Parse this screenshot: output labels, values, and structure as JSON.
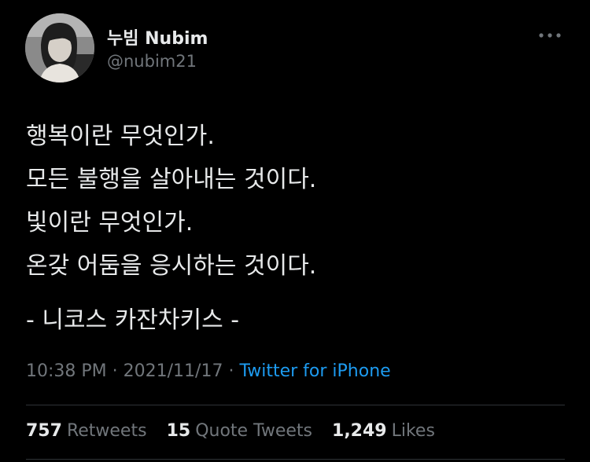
{
  "author": {
    "name": "누빔 Nubim",
    "handle": "@nubim21"
  },
  "tweet": {
    "lines": [
      "행복이란 무엇인가.",
      "모든 불행을 살아내는 것이다.",
      "빛이란 무엇인가.",
      "온갖 어둠을 응시하는 것이다."
    ],
    "attribution": "- 니코스 카잔차키스 -"
  },
  "meta": {
    "time": "10:38 PM",
    "separator": " · ",
    "date": "2021/11/17",
    "source": "Twitter for iPhone"
  },
  "stats": [
    {
      "count": "757",
      "label": "Retweets"
    },
    {
      "count": "15",
      "label": "Quote Tweets"
    },
    {
      "count": "1,249",
      "label": "Likes"
    }
  ],
  "icons": {
    "more": "more-horizontal-icon"
  },
  "colors": {
    "background": "#000000",
    "text": "#e7e9ea",
    "secondary": "#71767b",
    "link": "#1d9bf0",
    "divider": "#2f3336"
  }
}
